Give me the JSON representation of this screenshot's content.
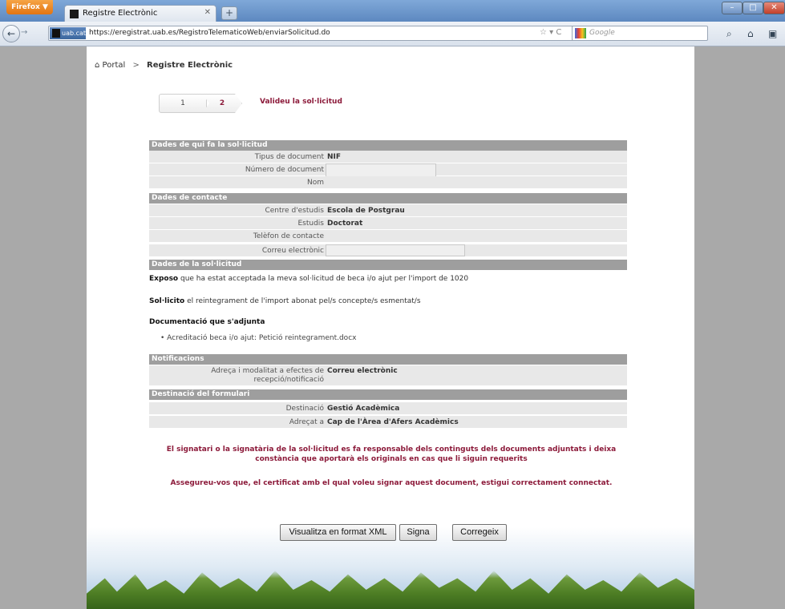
{
  "browser": {
    "app_button": "Firefox ▼",
    "tab_title": "Registre Electrònic",
    "new_tab": "+",
    "url": "https://eregistrat.uab.es/RegistroTelematicoWeb/enviarSolicitud.do",
    "site_identity": "uab.cat",
    "search_placeholder": "Google"
  },
  "breadcrumb": {
    "home": "Portal",
    "separator": ">",
    "current": "Registre Electrònic"
  },
  "steps": {
    "step1": "1",
    "step2": "2",
    "title": "Valideu la sol·licitud"
  },
  "sections": {
    "solicitant": "Dades de qui fa la sol·licitud",
    "contacte": "Dades de contacte",
    "solicitud": "Dades de la sol·licitud",
    "notificacions": "Notificacions",
    "destinacio": "Destinació del formulari"
  },
  "solicitant": {
    "tipus_label": "Tipus de document",
    "tipus_value": "NIF",
    "numero_label": "Número de document",
    "nom_label": "Nom"
  },
  "contacte": {
    "centre_label": "Centre d'estudis",
    "centre_value": "Escola de Postgrau",
    "estudis_label": "Estudis",
    "estudis_value": "Doctorat",
    "telefon_label": "Telèfon de contacte",
    "correu_label": "Correu electrònic"
  },
  "solicitud": {
    "exposo_bold": "Exposo",
    "exposo_text": " que ha estat acceptada la meva sol·licitud de beca i/o ajut per l'import de 1020",
    "solicito_bold": "Sol·licito",
    "solicito_text": " el reintegrament de l'import abonat pel/s concepte/s esmentat/s",
    "documentacio_title": "Documentació que s'adjunta",
    "attachment": "Acreditació beca i/o ajut: Petició reintegrament.docx"
  },
  "notificacions": {
    "adreca_label_1": "Adreça i modalitat a efectes de",
    "adreca_label_2": "recepció/notificació",
    "adreca_value": "Correu electrònic"
  },
  "destinacio": {
    "destinacio_label": "Destinació",
    "destinacio_value": "Gestió Acadèmica",
    "adrecat_label": "Adreçat a",
    "adrecat_value": "Cap de l'Àrea d'Afers Acadèmics"
  },
  "warnings": {
    "line1": "El signatari o la signatària de la sol·licitud es fa responsable dels continguts dels documents adjuntats i deixa",
    "line2": "constància que aportarà els originals en cas que li siguin requerits",
    "line3": "Assegureu-vos que, el certificat amb el qual voleu signar aquest document, estigui correctament connectat."
  },
  "buttons": {
    "xml": "Visualitza en format XML",
    "signa": "Signa",
    "corregeix": "Corregeix"
  },
  "colors": {
    "accent": "#8c1a3a",
    "section_header": "#9e9e9e"
  }
}
